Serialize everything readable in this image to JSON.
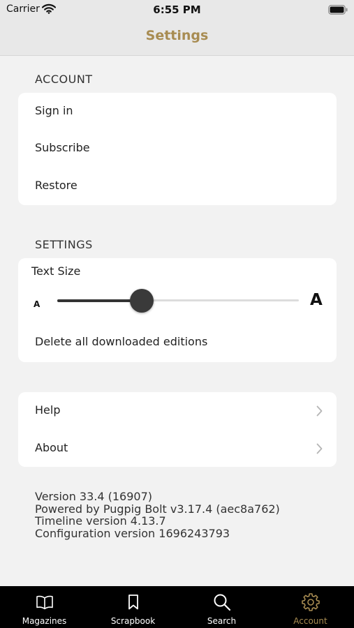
{
  "status_bar": {
    "carrier": "Carrier",
    "time": "6:55 PM"
  },
  "nav": {
    "title": "Settings"
  },
  "account_section": {
    "header": "ACCOUNT",
    "items": [
      {
        "label": "Sign in"
      },
      {
        "label": "Subscribe"
      },
      {
        "label": "Restore"
      }
    ]
  },
  "settings_section": {
    "header": "SETTINGS",
    "text_size": {
      "label": "Text Size",
      "small_glyph": "A",
      "large_glyph": "A",
      "level": 0.35
    },
    "delete_label": "Delete all downloaded editions"
  },
  "info_section": {
    "items": [
      {
        "label": "Help",
        "icon": "chevron-right-icon"
      },
      {
        "label": "About",
        "icon": "chevron-right-icon"
      }
    ]
  },
  "version_info": {
    "version": "Version 33.4 (16907)",
    "powered_by": "Powered by Pugpig Bolt v3.17.4 (aec8a762)",
    "timeline": "Timeline version 4.13.7",
    "configuration": "Configuration version 1696243793"
  },
  "tab_bar": {
    "tabs": [
      {
        "label": "Magazines",
        "icon": "open-book-icon"
      },
      {
        "label": "Scrapbook",
        "icon": "bookmark-icon"
      },
      {
        "label": "Search",
        "icon": "search-icon"
      },
      {
        "label": "Account",
        "icon": "gear-icon"
      }
    ],
    "active_tab": "Account"
  },
  "colors": {
    "accent": "#a88c52",
    "background": "#f2f2f2",
    "card": "#ffffff",
    "tab_bar": "#000000",
    "slider_thumb": "#3a3a3a"
  }
}
